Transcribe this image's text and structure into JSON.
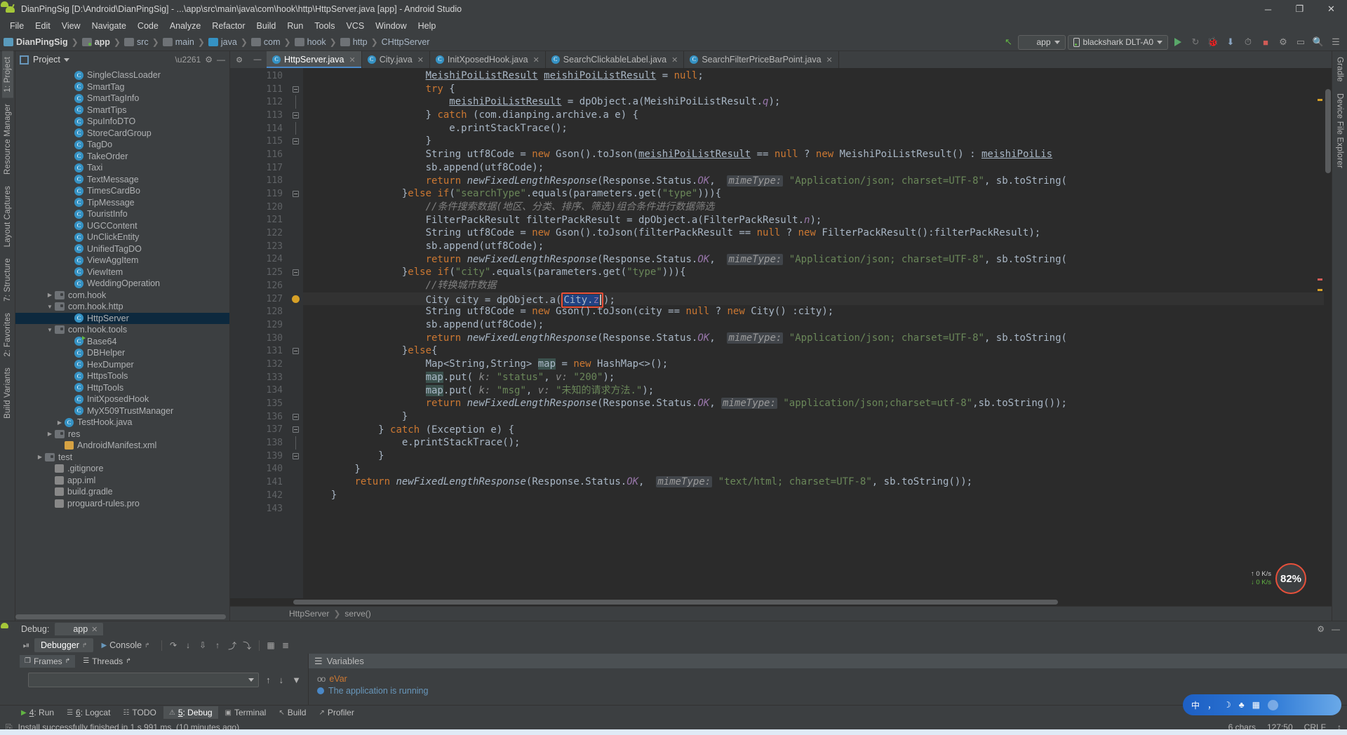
{
  "window": {
    "title": "DianPingSig [D:\\Android\\DianPingSig] - ...\\app\\src\\main\\java\\com\\hook\\http\\HttpServer.java [app] - Android Studio",
    "minimize": "─",
    "maximize": "❐",
    "close": "✕"
  },
  "menu": [
    "File",
    "Edit",
    "View",
    "Navigate",
    "Code",
    "Analyze",
    "Refactor",
    "Build",
    "Run",
    "Tools",
    "VCS",
    "Window",
    "Help"
  ],
  "breadcrumb": [
    {
      "label": "DianPingSig",
      "icon": "project-icon",
      "bold": true
    },
    {
      "label": "app",
      "icon": "module-icon",
      "bold": true
    },
    {
      "label": "src",
      "icon": "folder-icon",
      "bold": false
    },
    {
      "label": "main",
      "icon": "folder-icon",
      "bold": false
    },
    {
      "label": "java",
      "icon": "source-folder-icon",
      "bold": false
    },
    {
      "label": "com",
      "icon": "package-icon",
      "bold": false
    },
    {
      "label": "hook",
      "icon": "package-icon",
      "bold": false
    },
    {
      "label": "http",
      "icon": "package-icon",
      "bold": false
    },
    {
      "label": "HttpServer",
      "icon": "class-icon",
      "bold": false
    }
  ],
  "toolbar": {
    "back_arrow": "↖",
    "run_config": "app",
    "device": "blackshark DLT-A0",
    "run": "▶",
    "rerun": "↻",
    "debug": "🐞",
    "attach": "⬇",
    "profile": "⏱",
    "stop": "■",
    "sdk_manager": "⚙",
    "avd_manager": "▭",
    "search": "🔍",
    "menu": "☰"
  },
  "left_strip": [
    {
      "label": "1: Project",
      "active": true
    },
    {
      "label": "Resource Manager",
      "active": false
    },
    {
      "label": "Layout Captures",
      "active": false
    },
    {
      "label": "7: Structure",
      "active": false
    },
    {
      "label": "2: Favorites",
      "active": false
    },
    {
      "label": "Build Variants",
      "active": false
    }
  ],
  "right_strip": [
    {
      "label": "Gradle",
      "active": false
    },
    {
      "label": "Device File Explorer",
      "active": false
    }
  ],
  "project_panel": {
    "title": "Project",
    "collapse_icon": "collapse-all-icon",
    "settings_icon": "gear-icon",
    "hide_icon": "hide-icon",
    "tree": [
      {
        "label": "SingleClassLoader",
        "indent": 5,
        "type": "class",
        "arrow": "",
        "selected": false
      },
      {
        "label": "SmartTag",
        "indent": 5,
        "type": "class",
        "arrow": "",
        "selected": false
      },
      {
        "label": "SmartTagInfo",
        "indent": 5,
        "type": "class",
        "arrow": "",
        "selected": false
      },
      {
        "label": "SmartTips",
        "indent": 5,
        "type": "class",
        "arrow": "",
        "selected": false
      },
      {
        "label": "SpuInfoDTO",
        "indent": 5,
        "type": "class",
        "arrow": "",
        "selected": false
      },
      {
        "label": "StoreCardGroup",
        "indent": 5,
        "type": "class",
        "arrow": "",
        "selected": false
      },
      {
        "label": "TagDo",
        "indent": 5,
        "type": "class",
        "arrow": "",
        "selected": false
      },
      {
        "label": "TakeOrder",
        "indent": 5,
        "type": "class",
        "arrow": "",
        "selected": false
      },
      {
        "label": "Taxi",
        "indent": 5,
        "type": "class",
        "arrow": "",
        "selected": false
      },
      {
        "label": "TextMessage",
        "indent": 5,
        "type": "class",
        "arrow": "",
        "selected": false
      },
      {
        "label": "TimesCardBo",
        "indent": 5,
        "type": "class",
        "arrow": "",
        "selected": false
      },
      {
        "label": "TipMessage",
        "indent": 5,
        "type": "class",
        "arrow": "",
        "selected": false
      },
      {
        "label": "TouristInfo",
        "indent": 5,
        "type": "class",
        "arrow": "",
        "selected": false
      },
      {
        "label": "UGCContent",
        "indent": 5,
        "type": "class",
        "arrow": "",
        "selected": false
      },
      {
        "label": "UnClickEntity",
        "indent": 5,
        "type": "class",
        "arrow": "",
        "selected": false
      },
      {
        "label": "UnifiedTagDO",
        "indent": 5,
        "type": "class",
        "arrow": "",
        "selected": false
      },
      {
        "label": "ViewAggItem",
        "indent": 5,
        "type": "class",
        "arrow": "",
        "selected": false
      },
      {
        "label": "ViewItem",
        "indent": 5,
        "type": "class",
        "arrow": "",
        "selected": false
      },
      {
        "label": "WeddingOperation",
        "indent": 5,
        "type": "class",
        "arrow": "",
        "selected": false
      },
      {
        "label": "com.hook",
        "indent": 3,
        "type": "package",
        "arrow": "▶",
        "selected": false
      },
      {
        "label": "com.hook.http",
        "indent": 3,
        "type": "package",
        "arrow": "▼",
        "selected": false
      },
      {
        "label": "HttpServer",
        "indent": 5,
        "type": "class",
        "arrow": "",
        "selected": true
      },
      {
        "label": "com.hook.tools",
        "indent": 3,
        "type": "package",
        "arrow": "▼",
        "selected": false
      },
      {
        "label": "Base64",
        "indent": 5,
        "type": "class-runnable",
        "arrow": "",
        "selected": false
      },
      {
        "label": "DBHelper",
        "indent": 5,
        "type": "class",
        "arrow": "",
        "selected": false
      },
      {
        "label": "HexDumper",
        "indent": 5,
        "type": "class",
        "arrow": "",
        "selected": false
      },
      {
        "label": "HttpsTools",
        "indent": 5,
        "type": "class",
        "arrow": "",
        "selected": false
      },
      {
        "label": "HttpTools",
        "indent": 5,
        "type": "class",
        "arrow": "",
        "selected": false
      },
      {
        "label": "InitXposedHook",
        "indent": 5,
        "type": "class",
        "arrow": "",
        "selected": false
      },
      {
        "label": "MyX509TrustManager",
        "indent": 5,
        "type": "class",
        "arrow": "",
        "selected": false
      },
      {
        "label": "TestHook.java",
        "indent": 4,
        "type": "class",
        "arrow": "▶",
        "selected": false
      },
      {
        "label": "res",
        "indent": 3,
        "type": "folder",
        "arrow": "▶",
        "selected": false
      },
      {
        "label": "AndroidManifest.xml",
        "indent": 4,
        "type": "xml",
        "arrow": "",
        "selected": false
      },
      {
        "label": "test",
        "indent": 2,
        "type": "folder",
        "arrow": "▶",
        "selected": false
      },
      {
        "label": ".gitignore",
        "indent": 3,
        "type": "file",
        "arrow": "",
        "selected": false
      },
      {
        "label": "app.iml",
        "indent": 3,
        "type": "file",
        "arrow": "",
        "selected": false
      },
      {
        "label": "build.gradle",
        "indent": 3,
        "type": "gradle",
        "arrow": "",
        "selected": false
      },
      {
        "label": "proguard-rules.pro",
        "indent": 3,
        "type": "file",
        "arrow": "",
        "selected": false
      }
    ]
  },
  "editor_tabs": [
    {
      "label": "HttpServer.java",
      "active": true
    },
    {
      "label": "City.java",
      "active": false
    },
    {
      "label": "InitXposedHook.java",
      "active": false
    },
    {
      "label": "SearchClickableLabel.java",
      "active": false
    },
    {
      "label": "SearchFilterPriceBarPoint.java",
      "active": false
    }
  ],
  "editor": {
    "first_line": 110,
    "line_numbers": [
      110,
      111,
      112,
      113,
      114,
      115,
      116,
      117,
      118,
      119,
      120,
      121,
      122,
      123,
      124,
      125,
      126,
      127,
      128,
      129,
      130,
      131,
      132,
      133,
      134,
      135,
      136,
      137,
      138,
      139,
      140,
      141,
      142,
      143
    ],
    "current_line": 127,
    "selection_text": "City.z",
    "breadcrumb_bottom": [
      "HttpServer",
      "serve()"
    ]
  },
  "debug": {
    "label": "Debug:",
    "config": "app",
    "close": "✕",
    "tabs": [
      {
        "label": "Debugger",
        "active": true
      },
      {
        "label": "Console",
        "active": false
      }
    ],
    "pane_tabs": [
      {
        "label": "Frames",
        "active": true
      },
      {
        "label": "Threads",
        "active": false
      }
    ],
    "variables_title": "Variables",
    "variables": [
      {
        "name": "eVar",
        "value": ""
      },
      {
        "name": "",
        "value": "The application is running"
      }
    ],
    "settings_icon": "gear-icon",
    "hide_icon": "hide-icon"
  },
  "tool_windows": [
    {
      "num": "4",
      "label": "Run",
      "icon": "run-icon",
      "active": false
    },
    {
      "num": "6",
      "label": "Logcat",
      "icon": "logcat-icon",
      "active": false
    },
    {
      "num": "",
      "label": "TODO",
      "icon": "todo-icon",
      "active": false
    },
    {
      "num": "5",
      "label": "Debug",
      "icon": "debug-icon",
      "active": true
    },
    {
      "num": "",
      "label": "Terminal",
      "icon": "terminal-icon",
      "active": false
    },
    {
      "num": "",
      "label": "Build",
      "icon": "build-icon",
      "active": false
    },
    {
      "num": "",
      "label": "Profiler",
      "icon": "profiler-icon",
      "active": false
    }
  ],
  "status_bar": {
    "message": "Install successfully finished in 1 s 991 ms. (10 minutes ago)",
    "chars": "6 chars",
    "position": "127:50",
    "line_sep": "CRLF",
    "encoding": "↕"
  },
  "overlay": {
    "perf_value": "82%",
    "net_up": "↑ 0   K/s",
    "net_down": "↓ 0   K/s",
    "ime_lang": "中",
    "ime_punct": "，",
    "ime_moon": "☽",
    "ime_icon1": "♣",
    "ime_icon2": "▦"
  },
  "code_lines": [
    {
      "n": 110,
      "fold": "",
      "html": "                    <u>MeishiPoiListResult</u> <u>meishiPoiListResult</u> = <span class=\"kw\">null</span>;"
    },
    {
      "n": 111,
      "fold": "box",
      "html": "                    <span class=\"kw\">try</span> {"
    },
    {
      "n": 112,
      "fold": "bar",
      "html": "                        <span class=\"undl\">meishiPoiListResult</span> = dpObject.a(MeishiPoiListResult.<span class=\"fld ital\">q</span>);"
    },
    {
      "n": 113,
      "fold": "box",
      "html": "                    } <span class=\"kw\">catch</span> (com.dianping.archive.a e) {"
    },
    {
      "n": 114,
      "fold": "bar",
      "html": "                        e.printStackTrace();"
    },
    {
      "n": 115,
      "fold": "box",
      "html": "                    }"
    },
    {
      "n": 116,
      "fold": "",
      "html": "                    String utf8Code = <span class=\"kw\">new</span> Gson().toJson(<span class=\"undl\">meishiPoiListResult</span> == <span class=\"kw\">null</span> ? <span class=\"kw\">new</span> MeishiPoiListResult() : <span class=\"undl\">meishiPoiLis</span>"
    },
    {
      "n": 117,
      "fold": "",
      "html": "                    sb.append(utf8Code);"
    },
    {
      "n": 118,
      "fold": "",
      "html": "                    <span class=\"kw\">return</span> <span class=\"ital\">newFixedLengthResponse</span>(Response.Status.<span class=\"fld ital\">OK</span>,  <span class=\"hintbg\">mimeType:</span> <span class=\"str\">\"Application/json; charset=UTF-8\"</span>, sb.toString("
    },
    {
      "n": 119,
      "fold": "box",
      "html": "                }<span class=\"kw\">else if</span>(<span class=\"str\">\"searchType\"</span>.equals(parameters.get(<span class=\"str\">\"type\"</span>))){"
    },
    {
      "n": 120,
      "fold": "",
      "html": "                    <span class=\"cmt\">//条件搜索数据(地区、分类、排序、筛选)组合条件进行数据筛选</span>"
    },
    {
      "n": 121,
      "fold": "",
      "html": "                    FilterPackResult filterPackResult = dpObject.a(FilterPackResult.<span class=\"fld ital\">n</span>);"
    },
    {
      "n": 122,
      "fold": "",
      "html": "                    String utf8Code = <span class=\"kw\">new</span> Gson().toJson(filterPackResult == <span class=\"kw\">null</span> ? <span class=\"kw\">new</span> FilterPackResult():filterPackResult);"
    },
    {
      "n": 123,
      "fold": "",
      "html": "                    sb.append(utf8Code);"
    },
    {
      "n": 124,
      "fold": "",
      "html": "                    <span class=\"kw\">return</span> <span class=\"ital\">newFixedLengthResponse</span>(Response.Status.<span class=\"fld ital\">OK</span>,  <span class=\"hintbg\">mimeType:</span> <span class=\"str\">\"Application/json; charset=UTF-8\"</span>, sb.toString("
    },
    {
      "n": 125,
      "fold": "box",
      "html": "                }<span class=\"kw\">else if</span>(<span class=\"str\">\"city\"</span>.equals(parameters.get(<span class=\"str\">\"type\"</span>))){"
    },
    {
      "n": 126,
      "fold": "",
      "html": "                    <span class=\"cmt\">//转换城市数据</span>"
    },
    {
      "n": 127,
      "fold": "bulb",
      "html": "                    City city = dpObject.a(<span class=\"renamebox\"><span class=\"selbg\">City.<span class=\"fld\">z</span></span><span class=\"caretbar\"></span></span>);"
    },
    {
      "n": 128,
      "fold": "",
      "html": "                    String utf8Code = <span class=\"kw\">new</span> Gson().toJson(city == <span class=\"kw\">null</span> ? <span class=\"kw\">new</span> City() :city);"
    },
    {
      "n": 129,
      "fold": "",
      "html": "                    sb.append(utf8Code);"
    },
    {
      "n": 130,
      "fold": "",
      "html": "                    <span class=\"kw\">return</span> <span class=\"ital\">newFixedLengthResponse</span>(Response.Status.<span class=\"fld ital\">OK</span>,  <span class=\"hintbg\">mimeType:</span> <span class=\"str\">\"Application/json; charset=UTF-8\"</span>, sb.toString("
    },
    {
      "n": 131,
      "fold": "box",
      "html": "                }<span class=\"kw\">else</span>{"
    },
    {
      "n": 132,
      "fold": "",
      "html": "                    Map&lt;String,String&gt; <span class=\"varhl\">map</span> = <span class=\"kw\">new</span> HashMap&lt;&gt;();"
    },
    {
      "n": 133,
      "fold": "",
      "html": "                    <span class=\"varhl\">map</span>.put( <span class=\"hintp\">k:</span> <span class=\"str\">\"status\"</span>, <span class=\"hintp\">v:</span> <span class=\"str\">\"200\"</span>);"
    },
    {
      "n": 134,
      "fold": "",
      "html": "                    <span class=\"varhl\">map</span>.put( <span class=\"hintp\">k:</span> <span class=\"str\">\"msg\"</span>, <span class=\"hintp\">v:</span> <span class=\"str\">\"未知的请求方法.\"</span>);"
    },
    {
      "n": 135,
      "fold": "",
      "html": "                    <span class=\"kw\">return</span> <span class=\"ital\">newFixedLengthResponse</span>(Response.Status.<span class=\"fld ital\">OK</span>, <span class=\"hintbg\">mimeType:</span> <span class=\"str\">\"application/json;charset=utf-8\"</span>,sb.toString());"
    },
    {
      "n": 136,
      "fold": "box",
      "html": "                }"
    },
    {
      "n": 137,
      "fold": "box",
      "html": "            } <span class=\"kw\">catch</span> (Exception e) {"
    },
    {
      "n": 138,
      "fold": "bar",
      "html": "                e.printStackTrace();"
    },
    {
      "n": 139,
      "fold": "box",
      "html": "            }"
    },
    {
      "n": 140,
      "fold": "",
      "html": "        }"
    },
    {
      "n": 141,
      "fold": "",
      "html": "        <span class=\"kw\">return</span> <span class=\"ital\">newFixedLengthResponse</span>(Response.Status.<span class=\"fld ital\">OK</span>,  <span class=\"hintbg\">mimeType:</span> <span class=\"str\">\"text/html; charset=UTF-8\"</span>, sb.toString());"
    },
    {
      "n": 142,
      "fold": "",
      "html": "    }"
    },
    {
      "n": 143,
      "fold": "",
      "html": ""
    }
  ]
}
